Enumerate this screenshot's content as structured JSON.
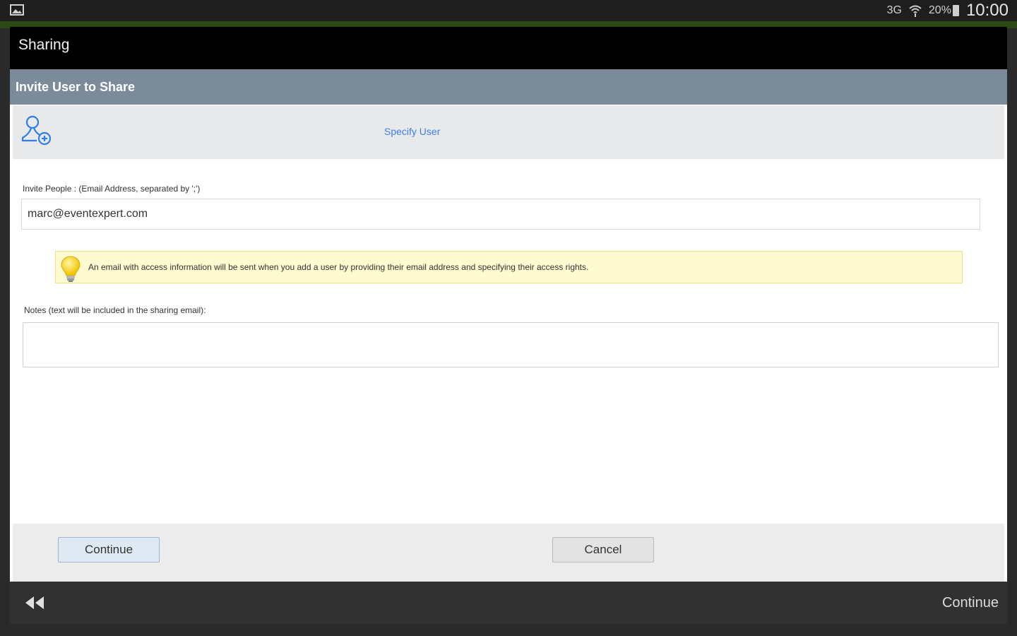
{
  "status_bar": {
    "network": "3G",
    "battery": "20%",
    "time": "10:00"
  },
  "dialog": {
    "title": "Sharing",
    "section_title": "Invite User to Share",
    "specify_user_link": "Specify User",
    "invite_label": "Invite People : (Email Address, separated by ';')",
    "invite_value": "marc@eventexpert.com",
    "tip_text": "An email with access information will be sent when you add a user by providing their email address and specifying their access rights.",
    "notes_label": "Notes (text will be included in the sharing email):",
    "notes_value": "",
    "continue_button": "Continue",
    "cancel_button": "Cancel"
  },
  "bottom_bar": {
    "continue_label": "Continue"
  },
  "colors": {
    "section_bar": "#7b8b99",
    "link": "#3c7ee8",
    "tip_background": "#fffbd1"
  }
}
